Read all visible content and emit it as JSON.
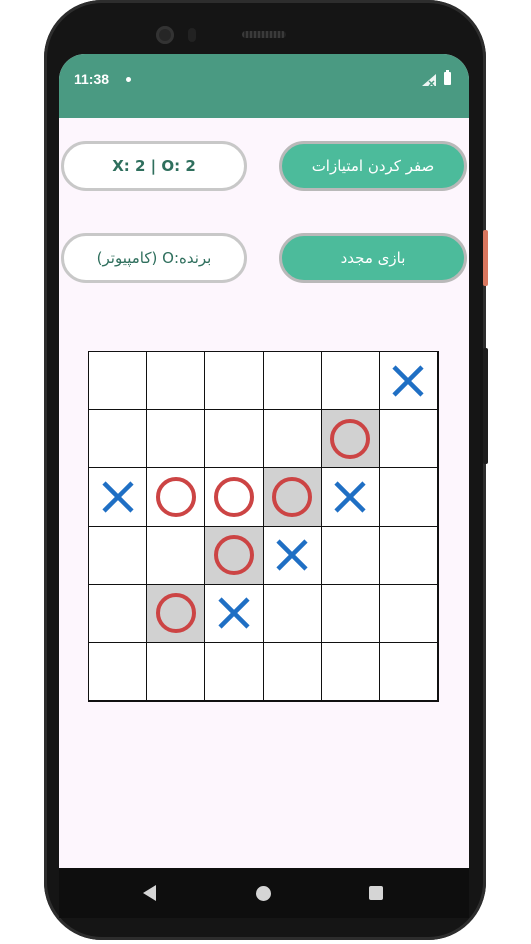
{
  "status_bar": {
    "time": "11:38",
    "icons": [
      "notification-dot-icon",
      "signal-icon",
      "battery-icon"
    ]
  },
  "score": {
    "text": "X: 2 | O: 2"
  },
  "winner": {
    "text": "برنده:O (کامپیوتر)"
  },
  "buttons": {
    "reset_score": "صفر کردن امتیازات",
    "new_game": "بازی مجدد"
  },
  "colors": {
    "status_bar": "#4a9a82",
    "button_fill": "#4cbb9b",
    "x_mark": "#1f6fc4",
    "o_mark": "#cc4444",
    "highlight": "#d1d1d1",
    "screen_bg": "#fdf6fd"
  },
  "board": {
    "rows": 6,
    "cols": 6,
    "cells": [
      [
        "",
        "",
        "",
        "",
        "",
        "X"
      ],
      [
        "",
        "",
        "",
        "",
        "O",
        ""
      ],
      [
        "X",
        "O",
        "O",
        "O",
        "X",
        ""
      ],
      [
        "",
        "",
        "O",
        "X",
        "",
        ""
      ],
      [
        "",
        "O",
        "X",
        "",
        "",
        ""
      ],
      [
        "",
        "",
        "",
        "",
        "",
        ""
      ]
    ],
    "highlighted": [
      [
        1,
        4
      ],
      [
        2,
        3
      ],
      [
        3,
        2
      ],
      [
        4,
        1
      ]
    ]
  },
  "nav": {
    "icons": [
      "back-icon",
      "home-icon",
      "recent-apps-icon"
    ]
  }
}
